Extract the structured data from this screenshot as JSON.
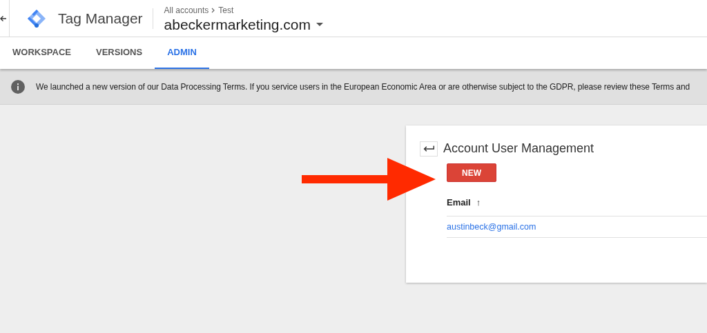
{
  "header": {
    "product": "Tag Manager",
    "breadcrumb": [
      "All accounts",
      "Test"
    ],
    "container": "abeckermarketing.com"
  },
  "tabs": [
    {
      "label": "WORKSPACE",
      "selected": false
    },
    {
      "label": "VERSIONS",
      "selected": false
    },
    {
      "label": "ADMIN",
      "selected": true
    }
  ],
  "notice": {
    "text": "We launched a new version of our Data Processing Terms. If you service users in the European Economic Area or are otherwise subject to the GDPR, please review these Terms and"
  },
  "panel": {
    "title": "Account User Management",
    "new_button": "NEW",
    "table": {
      "columns": [
        {
          "label": "Email",
          "sort": "↑"
        }
      ],
      "rows": [
        [
          "austinbeck@gmail.com"
        ]
      ]
    }
  }
}
